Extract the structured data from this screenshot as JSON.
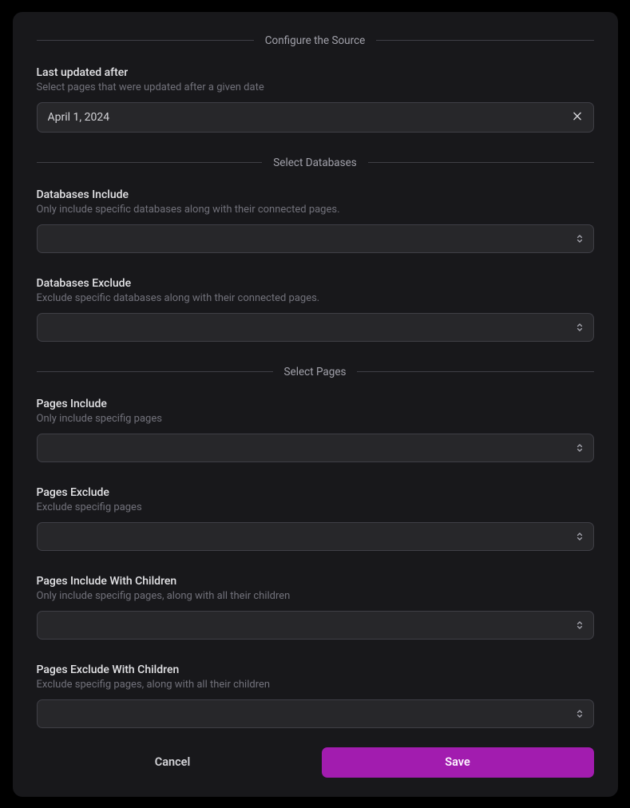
{
  "sections": {
    "configure": "Configure the Source",
    "databases": "Select Databases",
    "pages": "Select Pages"
  },
  "fields": {
    "lastUpdated": {
      "title": "Last updated after",
      "desc": "Select pages that were updated after a given date",
      "value": "April 1, 2024"
    },
    "dbInclude": {
      "title": "Databases Include",
      "desc": "Only include specific databases along with their connected pages.",
      "value": ""
    },
    "dbExclude": {
      "title": "Databases Exclude",
      "desc": "Exclude specific databases along with their connected pages.",
      "value": ""
    },
    "pagesInclude": {
      "title": "Pages Include",
      "desc": "Only include specifig pages",
      "value": ""
    },
    "pagesExclude": {
      "title": "Pages Exclude",
      "desc": "Exclude specifig pages",
      "value": ""
    },
    "pagesIncludeChildren": {
      "title": "Pages Include With Children",
      "desc": "Only include specifig pages, along with all their children",
      "value": ""
    },
    "pagesExcludeChildren": {
      "title": "Pages Exclude With Children",
      "desc": "Exclude specifig pages, along with all their children",
      "value": ""
    }
  },
  "buttons": {
    "cancel": "Cancel",
    "save": "Save"
  }
}
